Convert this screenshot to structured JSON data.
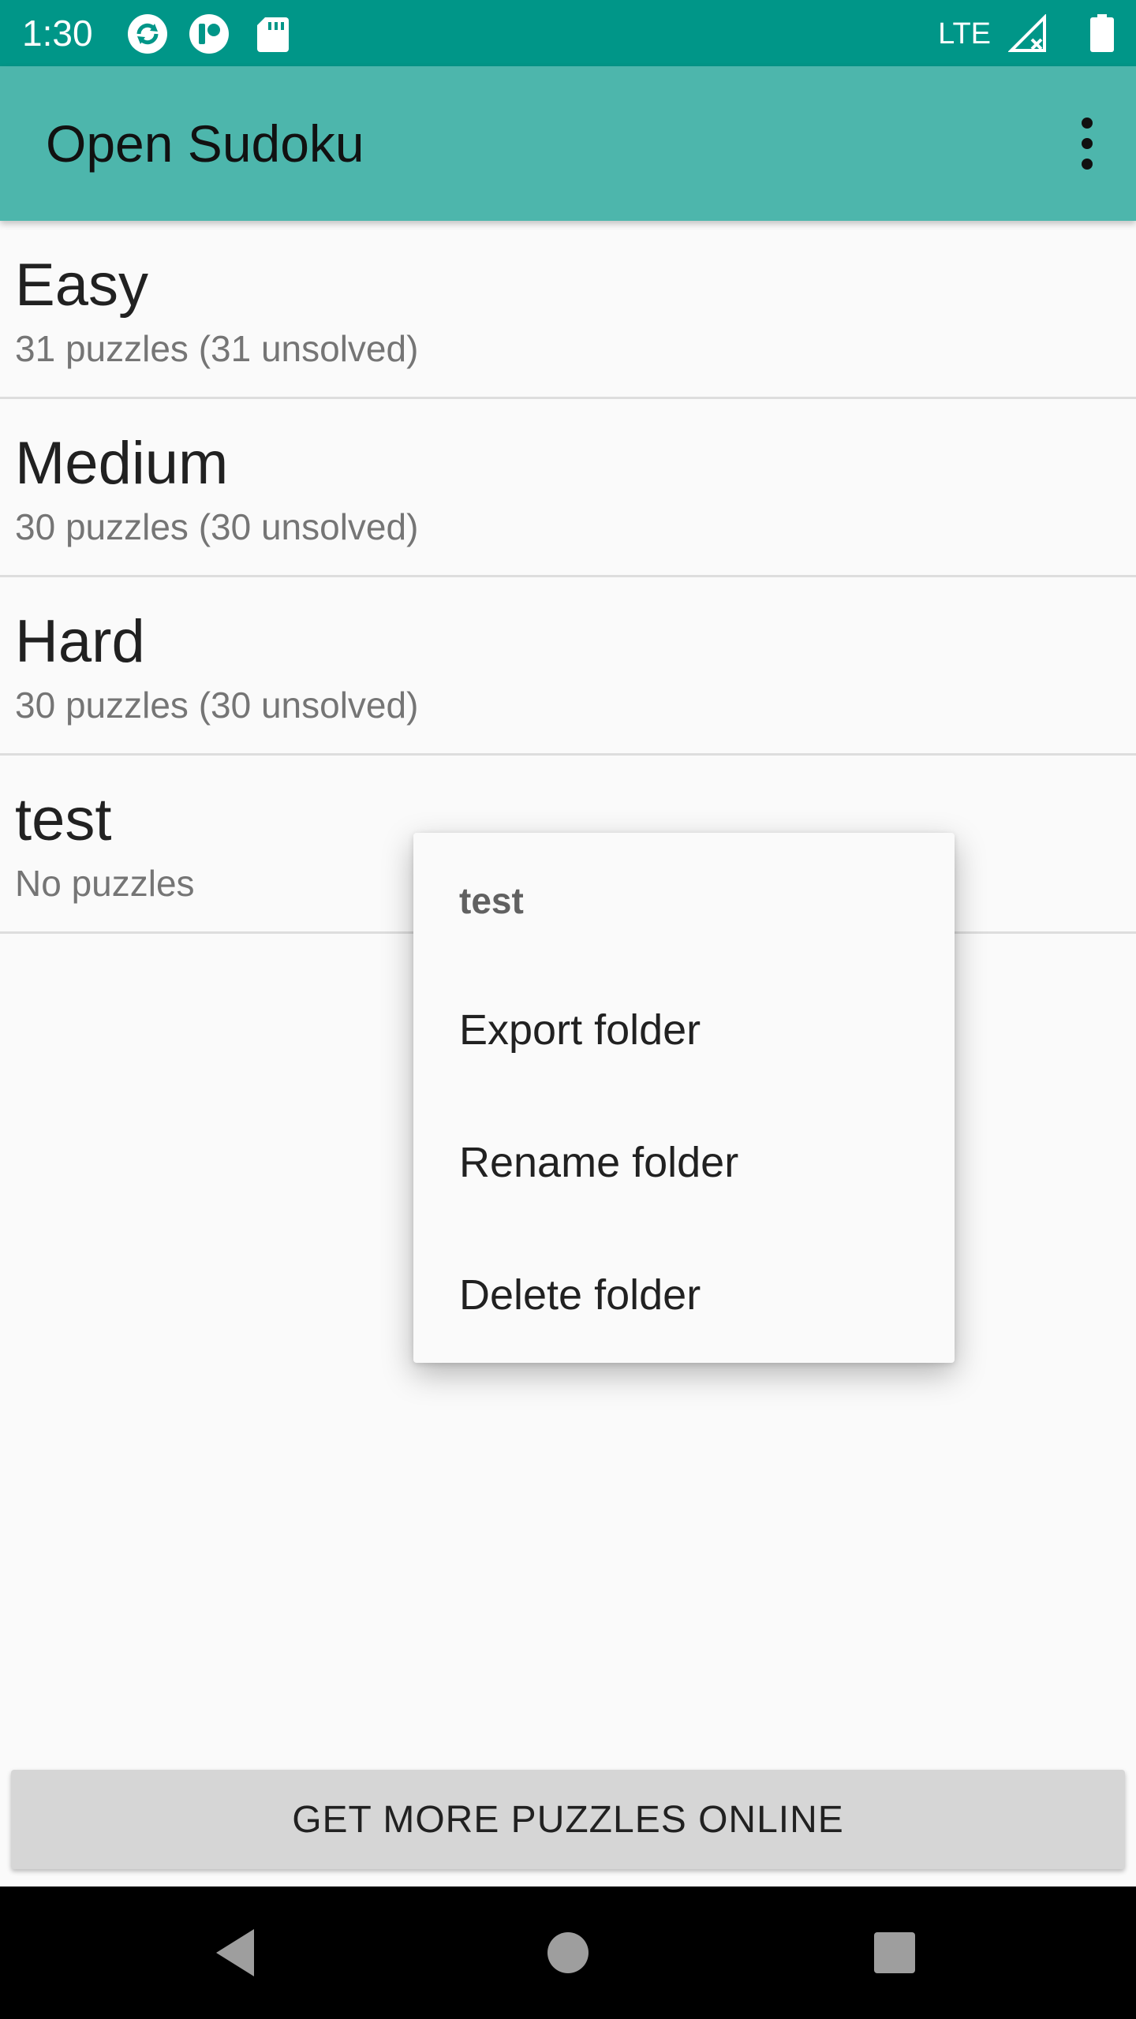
{
  "status_bar": {
    "time": "1:30",
    "network": "LTE",
    "icons": [
      "sync-icon",
      "app-notification-icon",
      "sd-card-icon",
      "signal-icon",
      "battery-icon"
    ]
  },
  "app_bar": {
    "title": "Open Sudoku",
    "menu_icon": "more-vert-icon"
  },
  "folders": [
    {
      "name": "Easy",
      "info": "31 puzzles (31 unsolved)"
    },
    {
      "name": "Medium",
      "info": "30 puzzles (30 unsolved)"
    },
    {
      "name": "Hard",
      "info": "30 puzzles (30 unsolved)"
    },
    {
      "name": "test",
      "info": "No puzzles"
    }
  ],
  "context_menu": {
    "title": "test",
    "items": [
      "Export folder",
      "Rename folder",
      "Delete folder"
    ]
  },
  "bottom_button": {
    "label": "GET MORE PUZZLES ONLINE"
  },
  "colors": {
    "status_bar": "#009688",
    "app_bar": "#4db6ac",
    "background": "#fafafa",
    "button": "#d6d6d6"
  }
}
